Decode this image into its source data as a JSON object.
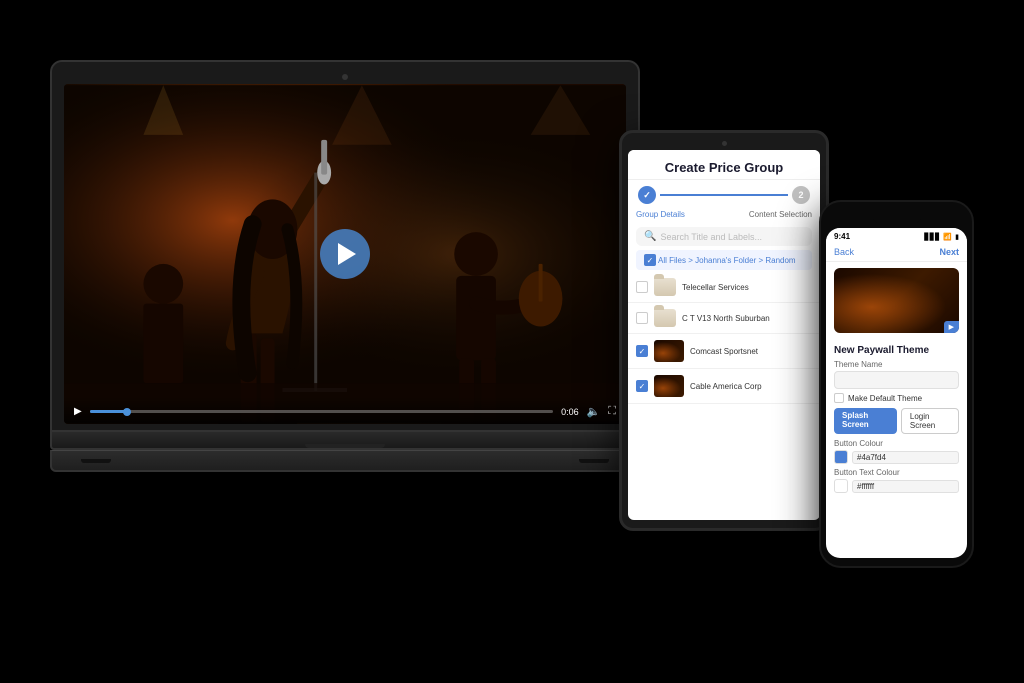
{
  "scene": {
    "background": "#000000"
  },
  "laptop": {
    "video": {
      "time_elapsed": "0:06",
      "progress_percent": 8
    }
  },
  "tablet": {
    "title": "Create Price Group",
    "steps": [
      {
        "label": "Group Details",
        "state": "active",
        "number": "1"
      },
      {
        "label": "Content Selection",
        "state": "inactive",
        "number": "2"
      }
    ],
    "search_placeholder": "Search Title and Labels...",
    "breadcrumb": "All Files > Johanna's Folder > Random",
    "files": [
      {
        "name": "Telecellar Services",
        "type": "folder",
        "checked": false
      },
      {
        "name": "C T V13 North Suburban",
        "type": "folder",
        "checked": false
      },
      {
        "name": "Comcast Sportsnet",
        "type": "video",
        "checked": true
      },
      {
        "name": "Cable America Corp",
        "type": "video",
        "checked": true
      }
    ]
  },
  "phone": {
    "time": "9:41",
    "back_label": "Back",
    "next_label": "Next",
    "section_title": "New Paywall Theme",
    "form": {
      "theme_name_label": "Theme Name",
      "theme_name_value": "",
      "default_checkbox_label": "Make Default Theme"
    },
    "buttons": {
      "splash_label": "Splash Screen",
      "login_label": "Login Screen"
    },
    "button_colour_label": "Button Colour",
    "button_colour_value": "#4a7fd4",
    "button_text_colour_label": "Button Text Colour",
    "button_text_colour_value": "#ffffff"
  }
}
